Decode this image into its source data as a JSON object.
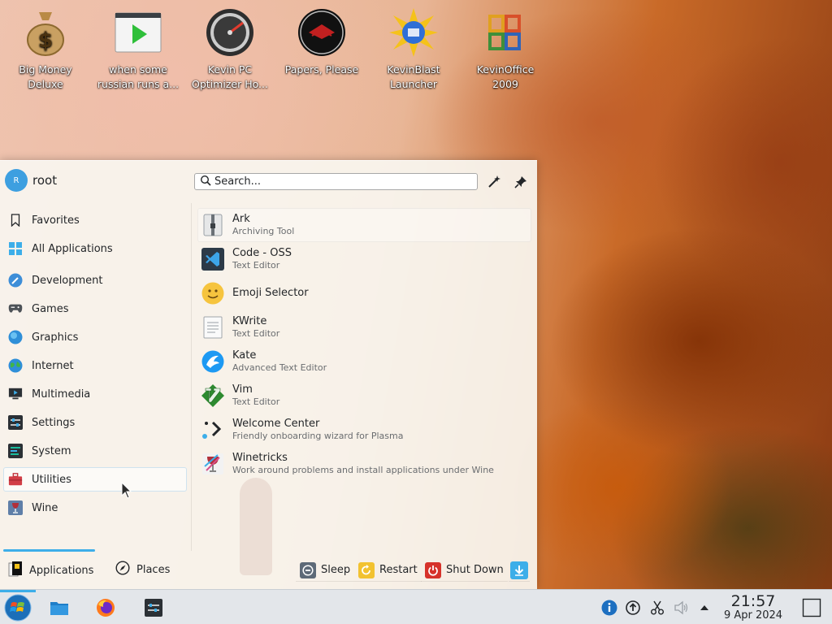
{
  "desktop": {
    "icons": [
      {
        "label": "Big Money Deluxe"
      },
      {
        "label": "when some russian runs a..."
      },
      {
        "label": "Kevin PC Optimizer Ho..."
      },
      {
        "label": "Papers, Please"
      },
      {
        "label": "KevinBlast Launcher"
      },
      {
        "label": "KevinOffice 2009"
      }
    ]
  },
  "launcher": {
    "user": {
      "initial": "R",
      "name": "root"
    },
    "search": {
      "placeholder": "Search..."
    },
    "categories": [
      {
        "label": "Favorites"
      },
      {
        "label": "All Applications"
      },
      {
        "label": "Development"
      },
      {
        "label": "Games"
      },
      {
        "label": "Graphics"
      },
      {
        "label": "Internet"
      },
      {
        "label": "Multimedia"
      },
      {
        "label": "Settings"
      },
      {
        "label": "System"
      },
      {
        "label": "Utilities"
      },
      {
        "label": "Wine"
      }
    ],
    "selected_category": "Utilities",
    "apps": [
      {
        "name": "Ark",
        "desc": "Archiving Tool"
      },
      {
        "name": "Code - OSS",
        "desc": "Text Editor"
      },
      {
        "name": "Emoji Selector",
        "desc": ""
      },
      {
        "name": "KWrite",
        "desc": "Text Editor"
      },
      {
        "name": "Kate",
        "desc": "Advanced Text Editor"
      },
      {
        "name": "Vim",
        "desc": "Text Editor"
      },
      {
        "name": "Welcome Center",
        "desc": "Friendly onboarding wizard for Plasma"
      },
      {
        "name": "Winetricks",
        "desc": "Work around problems and install applications under Wine"
      }
    ],
    "footer": {
      "tab_applications": "Applications",
      "tab_places": "Places",
      "sleep": "Sleep",
      "restart": "Restart",
      "shutdown": "Shut Down"
    }
  },
  "taskbar": {
    "clock_time": "21:57",
    "clock_date": "9 Apr 2024"
  },
  "colors": {
    "accent": "#3daee9",
    "shutdown_red": "#d6322a",
    "restart_yellow": "#f2c230"
  }
}
